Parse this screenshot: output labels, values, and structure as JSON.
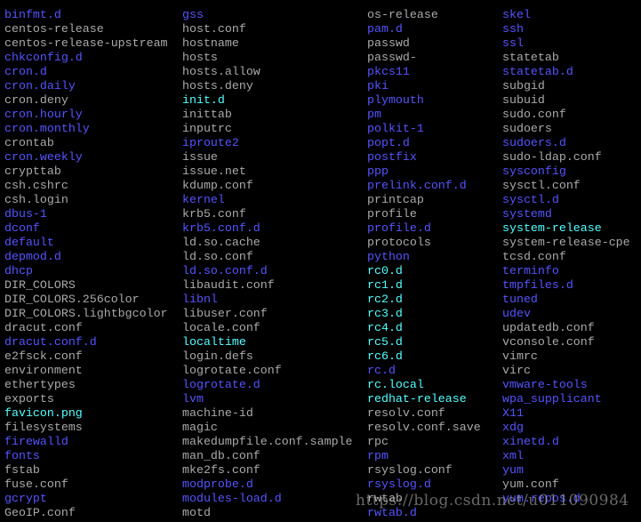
{
  "colors": {
    "file": "#aaaaaa",
    "dir": "#5555ff",
    "link": "#55ffff",
    "background": "#000000"
  },
  "columns": [
    [
      {
        "name": "binfmt.d",
        "type": "dir"
      },
      {
        "name": "centos-release",
        "type": "file"
      },
      {
        "name": "centos-release-upstream",
        "type": "file"
      },
      {
        "name": "chkconfig.d",
        "type": "dir"
      },
      {
        "name": "cron.d",
        "type": "dir"
      },
      {
        "name": "cron.daily",
        "type": "dir"
      },
      {
        "name": "cron.deny",
        "type": "file"
      },
      {
        "name": "cron.hourly",
        "type": "dir"
      },
      {
        "name": "cron.monthly",
        "type": "dir"
      },
      {
        "name": "crontab",
        "type": "file"
      },
      {
        "name": "cron.weekly",
        "type": "dir"
      },
      {
        "name": "crypttab",
        "type": "file"
      },
      {
        "name": "csh.cshrc",
        "type": "file"
      },
      {
        "name": "csh.login",
        "type": "file"
      },
      {
        "name": "dbus-1",
        "type": "dir"
      },
      {
        "name": "dconf",
        "type": "dir"
      },
      {
        "name": "default",
        "type": "dir"
      },
      {
        "name": "depmod.d",
        "type": "dir"
      },
      {
        "name": "dhcp",
        "type": "dir"
      },
      {
        "name": "DIR_COLORS",
        "type": "file"
      },
      {
        "name": "DIR_COLORS.256color",
        "type": "file"
      },
      {
        "name": "DIR_COLORS.lightbgcolor",
        "type": "file"
      },
      {
        "name": "dracut.conf",
        "type": "file"
      },
      {
        "name": "dracut.conf.d",
        "type": "dir"
      },
      {
        "name": "e2fsck.conf",
        "type": "file"
      },
      {
        "name": "environment",
        "type": "file"
      },
      {
        "name": "ethertypes",
        "type": "file"
      },
      {
        "name": "exports",
        "type": "file"
      },
      {
        "name": "favicon.png",
        "type": "link"
      },
      {
        "name": "filesystems",
        "type": "file"
      },
      {
        "name": "firewalld",
        "type": "dir"
      },
      {
        "name": "fonts",
        "type": "dir"
      },
      {
        "name": "fstab",
        "type": "file"
      },
      {
        "name": "fuse.conf",
        "type": "file"
      },
      {
        "name": "gcrypt",
        "type": "dir"
      },
      {
        "name": "GeoIP.conf",
        "type": "file"
      }
    ],
    [
      {
        "name": "gss",
        "type": "dir"
      },
      {
        "name": "host.conf",
        "type": "file"
      },
      {
        "name": "hostname",
        "type": "file"
      },
      {
        "name": "hosts",
        "type": "file"
      },
      {
        "name": "hosts.allow",
        "type": "file"
      },
      {
        "name": "hosts.deny",
        "type": "file"
      },
      {
        "name": "init.d",
        "type": "link"
      },
      {
        "name": "inittab",
        "type": "file"
      },
      {
        "name": "inputrc",
        "type": "file"
      },
      {
        "name": "iproute2",
        "type": "dir"
      },
      {
        "name": "issue",
        "type": "file"
      },
      {
        "name": "issue.net",
        "type": "file"
      },
      {
        "name": "kdump.conf",
        "type": "file"
      },
      {
        "name": "kernel",
        "type": "dir"
      },
      {
        "name": "krb5.conf",
        "type": "file"
      },
      {
        "name": "krb5.conf.d",
        "type": "dir"
      },
      {
        "name": "ld.so.cache",
        "type": "file"
      },
      {
        "name": "ld.so.conf",
        "type": "file"
      },
      {
        "name": "ld.so.conf.d",
        "type": "dir"
      },
      {
        "name": "libaudit.conf",
        "type": "file"
      },
      {
        "name": "libnl",
        "type": "dir"
      },
      {
        "name": "libuser.conf",
        "type": "file"
      },
      {
        "name": "locale.conf",
        "type": "file"
      },
      {
        "name": "localtime",
        "type": "link"
      },
      {
        "name": "login.defs",
        "type": "file"
      },
      {
        "name": "logrotate.conf",
        "type": "file"
      },
      {
        "name": "logrotate.d",
        "type": "dir"
      },
      {
        "name": "lvm",
        "type": "dir"
      },
      {
        "name": "machine-id",
        "type": "file"
      },
      {
        "name": "magic",
        "type": "file"
      },
      {
        "name": "makedumpfile.conf.sample",
        "type": "file"
      },
      {
        "name": "man_db.conf",
        "type": "file"
      },
      {
        "name": "mke2fs.conf",
        "type": "file"
      },
      {
        "name": "modprobe.d",
        "type": "dir"
      },
      {
        "name": "modules-load.d",
        "type": "dir"
      },
      {
        "name": "motd",
        "type": "file"
      }
    ],
    [
      {
        "name": "os-release",
        "type": "file"
      },
      {
        "name": "pam.d",
        "type": "dir"
      },
      {
        "name": "passwd",
        "type": "file"
      },
      {
        "name": "passwd-",
        "type": "file"
      },
      {
        "name": "pkcs11",
        "type": "dir"
      },
      {
        "name": "pki",
        "type": "dir"
      },
      {
        "name": "plymouth",
        "type": "dir"
      },
      {
        "name": "pm",
        "type": "dir"
      },
      {
        "name": "polkit-1",
        "type": "dir"
      },
      {
        "name": "popt.d",
        "type": "dir"
      },
      {
        "name": "postfix",
        "type": "dir"
      },
      {
        "name": "ppp",
        "type": "dir"
      },
      {
        "name": "prelink.conf.d",
        "type": "dir"
      },
      {
        "name": "printcap",
        "type": "file"
      },
      {
        "name": "profile",
        "type": "file"
      },
      {
        "name": "profile.d",
        "type": "dir"
      },
      {
        "name": "protocols",
        "type": "file"
      },
      {
        "name": "python",
        "type": "dir"
      },
      {
        "name": "rc0.d",
        "type": "link"
      },
      {
        "name": "rc1.d",
        "type": "link"
      },
      {
        "name": "rc2.d",
        "type": "link"
      },
      {
        "name": "rc3.d",
        "type": "link"
      },
      {
        "name": "rc4.d",
        "type": "link"
      },
      {
        "name": "rc5.d",
        "type": "link"
      },
      {
        "name": "rc6.d",
        "type": "link"
      },
      {
        "name": "rc.d",
        "type": "dir"
      },
      {
        "name": "rc.local",
        "type": "link"
      },
      {
        "name": "redhat-release",
        "type": "link"
      },
      {
        "name": "resolv.conf",
        "type": "file"
      },
      {
        "name": "resolv.conf.save",
        "type": "file"
      },
      {
        "name": "rpc",
        "type": "file"
      },
      {
        "name": "rpm",
        "type": "dir"
      },
      {
        "name": "rsyslog.conf",
        "type": "file"
      },
      {
        "name": "rsyslog.d",
        "type": "dir"
      },
      {
        "name": "rwtab",
        "type": "file"
      },
      {
        "name": "rwtab.d",
        "type": "dir"
      }
    ],
    [
      {
        "name": "skel",
        "type": "dir"
      },
      {
        "name": "ssh",
        "type": "dir"
      },
      {
        "name": "ssl",
        "type": "dir"
      },
      {
        "name": "statetab",
        "type": "file"
      },
      {
        "name": "statetab.d",
        "type": "dir"
      },
      {
        "name": "subgid",
        "type": "file"
      },
      {
        "name": "subuid",
        "type": "file"
      },
      {
        "name": "sudo.conf",
        "type": "file"
      },
      {
        "name": "sudoers",
        "type": "file"
      },
      {
        "name": "sudoers.d",
        "type": "dir"
      },
      {
        "name": "sudo-ldap.conf",
        "type": "file"
      },
      {
        "name": "sysconfig",
        "type": "dir"
      },
      {
        "name": "sysctl.conf",
        "type": "file"
      },
      {
        "name": "sysctl.d",
        "type": "dir"
      },
      {
        "name": "systemd",
        "type": "dir"
      },
      {
        "name": "system-release",
        "type": "link"
      },
      {
        "name": "system-release-cpe",
        "type": "file"
      },
      {
        "name": "tcsd.conf",
        "type": "file"
      },
      {
        "name": "terminfo",
        "type": "dir"
      },
      {
        "name": "tmpfiles.d",
        "type": "dir"
      },
      {
        "name": "tuned",
        "type": "dir"
      },
      {
        "name": "udev",
        "type": "dir"
      },
      {
        "name": "updatedb.conf",
        "type": "file"
      },
      {
        "name": "vconsole.conf",
        "type": "file"
      },
      {
        "name": "vimrc",
        "type": "file"
      },
      {
        "name": "virc",
        "type": "file"
      },
      {
        "name": "vmware-tools",
        "type": "dir"
      },
      {
        "name": "wpa_supplicant",
        "type": "dir"
      },
      {
        "name": "X11",
        "type": "dir"
      },
      {
        "name": "xdg",
        "type": "dir"
      },
      {
        "name": "xinetd.d",
        "type": "dir"
      },
      {
        "name": "xml",
        "type": "dir"
      },
      {
        "name": "yum",
        "type": "dir"
      },
      {
        "name": "yum.conf",
        "type": "file"
      },
      {
        "name": "yum.repos.d",
        "type": "dir"
      }
    ]
  ],
  "watermark": "https://blog.csdn.net/u011090984"
}
